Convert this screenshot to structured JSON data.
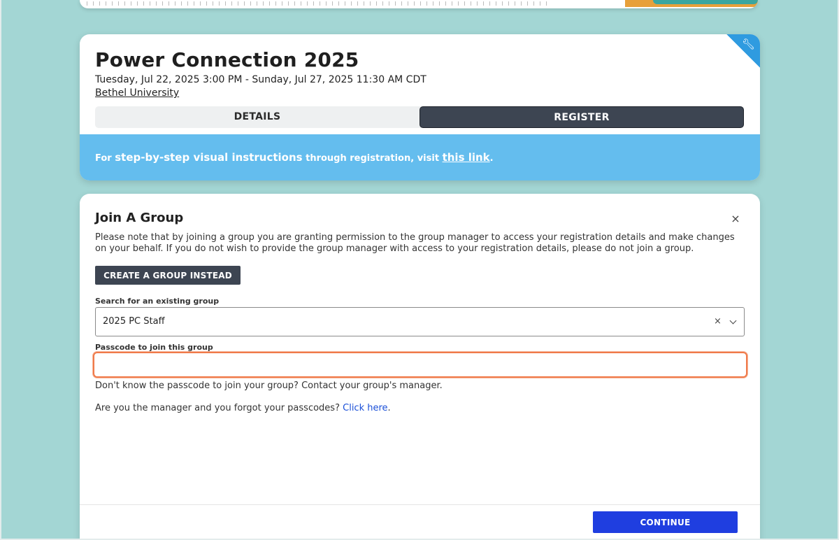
{
  "event": {
    "title": "Power Connection 2025",
    "dates": "Tuesday, Jul 22, 2025 3:00 PM - Sunday, Jul 27, 2025 11:30 AM CDT",
    "venue": "Bethel University",
    "tabs": [
      {
        "label": "DETAILS",
        "active": false
      },
      {
        "label": "REGISTER",
        "active": true
      }
    ],
    "banner": {
      "prefix": "For ",
      "strong": "step-by-step visual instructions",
      "middle": " through registration, visit ",
      "link": "this link",
      "suffix": "."
    }
  },
  "group": {
    "title": "Join A Group",
    "note": "Please note that by joining a group you are granting permission to the group manager to access your registration details and make changes on your behalf. If you do not wish to provide the group manager with access to your registration details, please do not join a group.",
    "create_button": "CREATE A GROUP INSTEAD",
    "search_label": "Search for an existing group",
    "search_value": "2025 PC Staff",
    "passcode_label": "Passcode to join this group",
    "passcode_value": "",
    "hint_1": "Don't know the passcode to join your group? Contact your group's manager.",
    "hint_2": "Are you the manager and you forgot your passcodes?",
    "hint_2_link": "Click here",
    "hint_2_suffix": ".",
    "close_symbol": "×",
    "clear_symbol": "×"
  },
  "footer": {
    "continue_button": "CONTINUE"
  },
  "colors": {
    "page_bg": "#a3d6d4",
    "banner": "#64bdee",
    "dark_button": "#3d4552",
    "primary_button": "#1f3ee0",
    "focus_border": "#f07a4a",
    "link": "#1a4fd8"
  },
  "icons": {
    "corner": "wrench-icon",
    "close": "close-icon",
    "clear": "clear-icon",
    "dropdown": "chevron-down-icon"
  }
}
